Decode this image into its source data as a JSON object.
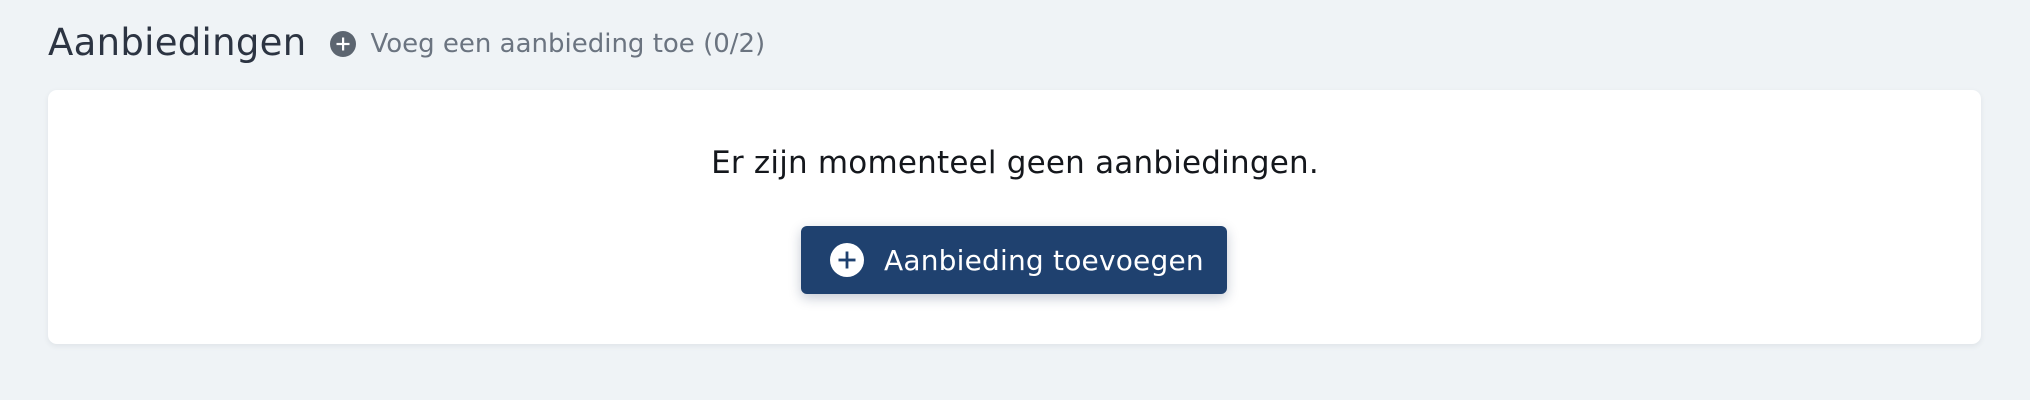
{
  "header": {
    "title": "Aanbiedingen",
    "add_link_label": "Voeg een aanbieding toe (0/2)"
  },
  "empty_state": {
    "message": "Er zijn momenteel geen aanbiedingen.",
    "button_label": "Aanbieding toevoegen"
  },
  "icons": {
    "header_add": "plus-circle-icon",
    "button_add": "plus-circle-icon"
  },
  "colors": {
    "background": "#eff3f6",
    "card": "#ffffff",
    "primary": "#1f416f",
    "muted_icon": "#5c6570",
    "title_text": "#2c3442"
  }
}
